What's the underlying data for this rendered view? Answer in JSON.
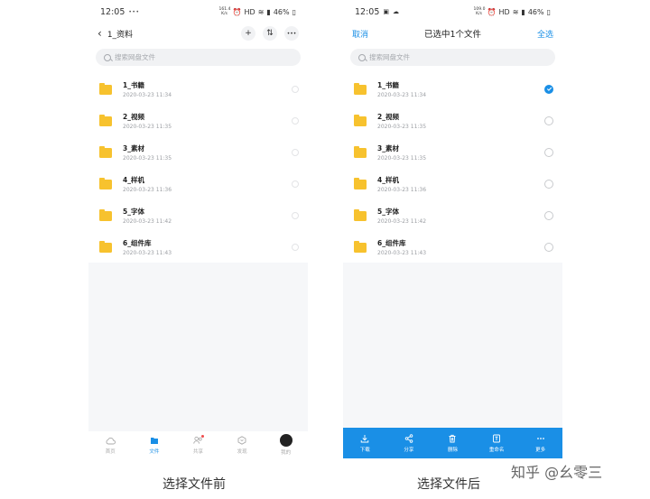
{
  "left_phone": {
    "status": {
      "time": "12:05",
      "notif": "•••",
      "speed": "161.4 K/s",
      "network": "HD",
      "battery": "46%"
    },
    "nav": {
      "back": "‹",
      "title": "1_资料",
      "add": "+",
      "sort": "⇅",
      "more": "•••"
    },
    "search": {
      "placeholder": "搜索网盘文件"
    },
    "files": [
      {
        "name": "1_书籍",
        "date": "2020-03-23  11:34"
      },
      {
        "name": "2_视频",
        "date": "2020-03-23  11:35"
      },
      {
        "name": "3_素材",
        "date": "2020-03-23  11:35"
      },
      {
        "name": "4_样机",
        "date": "2020-03-23  11:36"
      },
      {
        "name": "5_字体",
        "date": "2020-03-23  11:42"
      },
      {
        "name": "6_组件库",
        "date": "2020-03-23  11:43"
      }
    ],
    "tabs": [
      {
        "label": "首页",
        "icon": "cloud-icon"
      },
      {
        "label": "文件",
        "icon": "folder-icon"
      },
      {
        "label": "共享",
        "icon": "share-people-icon"
      },
      {
        "label": "发现",
        "icon": "discover-icon"
      },
      {
        "label": "我的",
        "icon": "avatar"
      }
    ]
  },
  "right_phone": {
    "status": {
      "time": "12:05",
      "speed": "109.0 K/s",
      "network": "HD",
      "battery": "46%"
    },
    "nav": {
      "cancel": "取消",
      "title": "已选中1个文件",
      "select_all": "全选"
    },
    "search": {
      "placeholder": "搜索网盘文件"
    },
    "files": [
      {
        "name": "1_书籍",
        "date": "2020-03-23  11:34",
        "checked": true
      },
      {
        "name": "2_视频",
        "date": "2020-03-23  11:35",
        "checked": false
      },
      {
        "name": "3_素材",
        "date": "2020-03-23  11:35",
        "checked": false
      },
      {
        "name": "4_样机",
        "date": "2020-03-23  11:36",
        "checked": false
      },
      {
        "name": "5_字体",
        "date": "2020-03-23  11:42",
        "checked": false
      },
      {
        "name": "6_组件库",
        "date": "2020-03-23  11:43",
        "checked": false
      }
    ],
    "actions": [
      {
        "label": "下载",
        "icon": "download-icon"
      },
      {
        "label": "分享",
        "icon": "share-icon"
      },
      {
        "label": "删除",
        "icon": "trash-icon"
      },
      {
        "label": "重命名",
        "icon": "rename-icon"
      },
      {
        "label": "更多",
        "icon": "more-icon"
      }
    ]
  },
  "captions": {
    "left": "选择文件前",
    "right": "选择文件后"
  },
  "watermark": "知乎 @幺零三",
  "colors": {
    "accent": "#1a8fe6",
    "folder": "#f7c22e",
    "badge": "#f04b4b"
  }
}
